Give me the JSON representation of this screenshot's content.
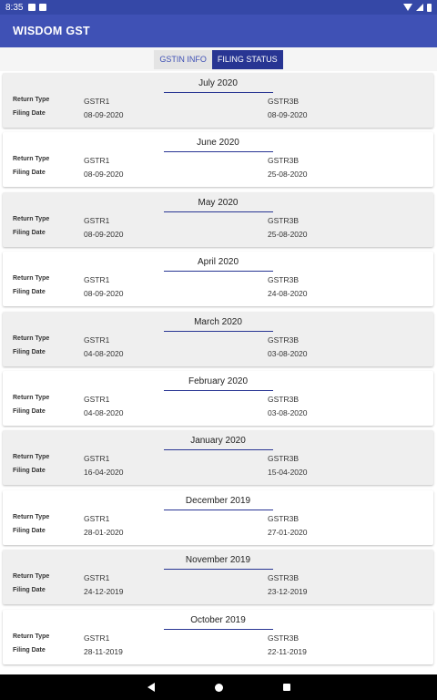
{
  "status_bar": {
    "time": "8:35",
    "icons": [
      "app-notification-icon",
      "sd-card-icon",
      "wifi-icon",
      "signal-icon",
      "battery-icon"
    ]
  },
  "app_bar": {
    "title": "WISDOM GST"
  },
  "tabs": [
    {
      "label": "GSTIN INFO",
      "active": false
    },
    {
      "label": "FILING STATUS",
      "active": true
    }
  ],
  "labels": {
    "return_type": "Return Type",
    "filing_date": "Filing Date"
  },
  "colors": {
    "primary": "#3f51b5",
    "primary_dark": "#283593",
    "status_bar": "#3548a7"
  },
  "filings": [
    {
      "month": "July 2020",
      "r1_type": "GSTR1",
      "r1_date": "08-09-2020",
      "r2_type": "GSTR3B",
      "r2_date": "08-09-2020"
    },
    {
      "month": "June 2020",
      "r1_type": "GSTR1",
      "r1_date": "08-09-2020",
      "r2_type": "GSTR3B",
      "r2_date": "25-08-2020"
    },
    {
      "month": "May 2020",
      "r1_type": "GSTR1",
      "r1_date": "08-09-2020",
      "r2_type": "GSTR3B",
      "r2_date": "25-08-2020"
    },
    {
      "month": "April 2020",
      "r1_type": "GSTR1",
      "r1_date": "08-09-2020",
      "r2_type": "GSTR3B",
      "r2_date": "24-08-2020"
    },
    {
      "month": "March 2020",
      "r1_type": "GSTR1",
      "r1_date": "04-08-2020",
      "r2_type": "GSTR3B",
      "r2_date": "03-08-2020"
    },
    {
      "month": "February 2020",
      "r1_type": "GSTR1",
      "r1_date": "04-08-2020",
      "r2_type": "GSTR3B",
      "r2_date": "03-08-2020"
    },
    {
      "month": "January 2020",
      "r1_type": "GSTR1",
      "r1_date": "16-04-2020",
      "r2_type": "GSTR3B",
      "r2_date": "15-04-2020"
    },
    {
      "month": "December 2019",
      "r1_type": "GSTR1",
      "r1_date": "28-01-2020",
      "r2_type": "GSTR3B",
      "r2_date": "27-01-2020"
    },
    {
      "month": "November 2019",
      "r1_type": "GSTR1",
      "r1_date": "24-12-2019",
      "r2_type": "GSTR3B",
      "r2_date": "23-12-2019"
    },
    {
      "month": "October 2019",
      "r1_type": "GSTR1",
      "r1_date": "28-11-2019",
      "r2_type": "GSTR3B",
      "r2_date": "22-11-2019"
    }
  ],
  "nav_bar": {
    "icons": [
      "back-icon",
      "home-icon",
      "recents-icon"
    ]
  }
}
